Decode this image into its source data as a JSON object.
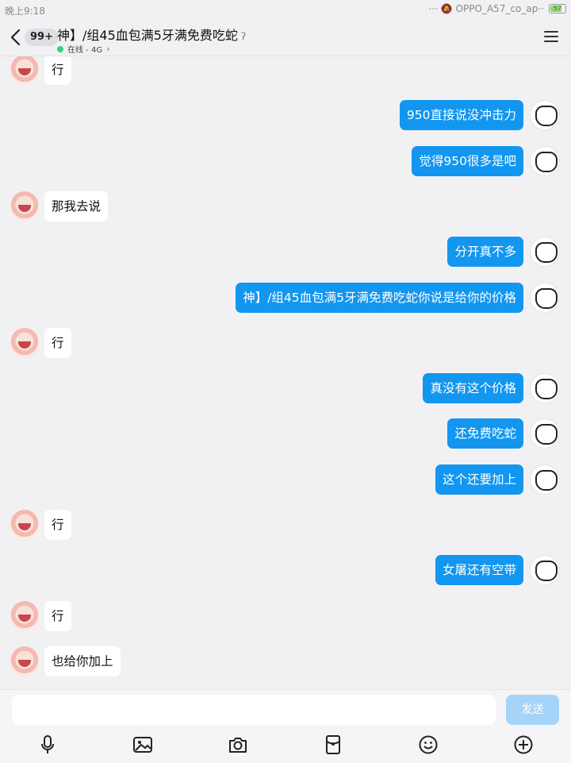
{
  "status_bar": {
    "time": "晚上9:18",
    "right_text": "··· 🔕 OPPO_A57_co_ap··",
    "battery": "57"
  },
  "header": {
    "unread_badge": "99+",
    "title": "神】/组45血包满5牙满免费吃蛇",
    "status_text": "在线 - 4G",
    "status_color": "#35d07f"
  },
  "messages": [
    {
      "side": "left",
      "text": "行"
    },
    {
      "side": "right",
      "text": "950直接说没冲击力"
    },
    {
      "side": "right",
      "text": "觉得950很多是吧"
    },
    {
      "side": "left",
      "text": "那我去说"
    },
    {
      "side": "right",
      "text": "分开真不多"
    },
    {
      "side": "right",
      "text": "神】/组45血包满5牙满免费吃蛇你说是给你的价格"
    },
    {
      "side": "left",
      "text": "行"
    },
    {
      "side": "right",
      "text": "真没有这个价格"
    },
    {
      "side": "right",
      "text": "还免费吃蛇"
    },
    {
      "side": "right",
      "text": "这个还要加上"
    },
    {
      "side": "left",
      "text": "行"
    },
    {
      "side": "right",
      "text": "女屠还有空带"
    },
    {
      "side": "left",
      "text": "行"
    },
    {
      "side": "left",
      "text": "也给你加上"
    }
  ],
  "input": {
    "placeholder": "",
    "send_label": "发送"
  },
  "toolbar": {
    "icons": [
      "microphone-icon",
      "image-icon",
      "camera-icon",
      "red-packet-icon",
      "emoji-icon",
      "plus-icon"
    ]
  },
  "colors": {
    "self_bubble": "#1296f0",
    "other_bubble": "#ffffff",
    "background": "#f1f1f3",
    "send_button_disabled": "#a5d4f8"
  }
}
